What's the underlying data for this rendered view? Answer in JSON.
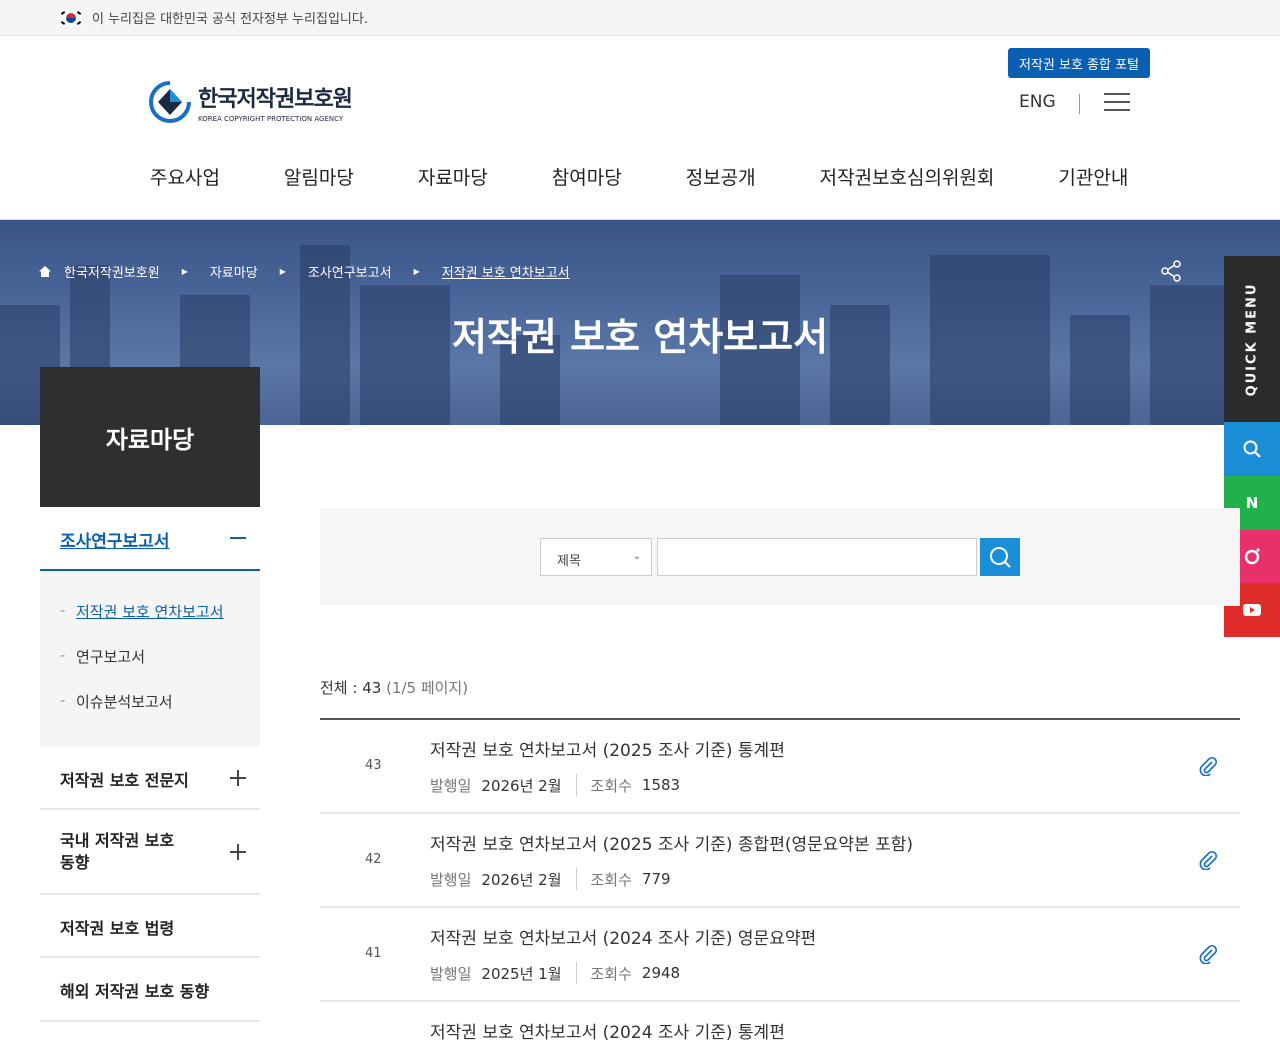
{
  "gov_bar": {
    "text": "이 누리집은 대한민국 공식 전자정부 누리집입니다."
  },
  "header": {
    "logo_name": "한국저작권보호원",
    "logo_sub": "KOREA COPYRIGHT PROTECTION AGENCY",
    "portal_button": "저작권 보호 종합 포털",
    "eng": "ENG"
  },
  "gnb": [
    "주요사업",
    "알림마당",
    "자료마당",
    "참여마당",
    "정보공개",
    "저작권보호심의위원회",
    "기관안내"
  ],
  "breadcrumb": [
    "한국저작권보호원",
    "자료마당",
    "조사연구보고서",
    "저작권 보호 연차보고서"
  ],
  "hero_title": "저작권 보호 연차보고서",
  "quick_menu": {
    "label": "QUICK MENU",
    "colors": [
      "#1a8fd8",
      "#21b14b",
      "#e8306a",
      "#e02b2b"
    ],
    "naver": "N"
  },
  "sidebar": {
    "title": "자료마당",
    "active": "조사연구보고서",
    "sub_items": [
      "저작권 보호 연차보고서",
      "연구보고서",
      "이슈분석보고서"
    ],
    "items": [
      "저작권 보호 전문지",
      "국내 저작권 보호\n동향",
      "저작권 보호 법령",
      "해외 저작권 보호 동향"
    ]
  },
  "search": {
    "select_value": "제목",
    "keyword": ""
  },
  "list": {
    "total_label": "전체 : 43",
    "page_info": "(1/5 페이지)",
    "date_label": "발행일",
    "views_label": "조회수",
    "rows": [
      {
        "no": "43",
        "title": "저작권 보호 연차보고서 (2025 조사 기준) 통계편",
        "date": "2026년 2월",
        "views": "1583"
      },
      {
        "no": "42",
        "title": "저작권 보호 연차보고서 (2025 조사 기준) 종합편(영문요약본 포함)",
        "date": "2026년 2월",
        "views": "779"
      },
      {
        "no": "41",
        "title": "저작권 보호 연차보고서 (2024 조사 기준) 영문요약편",
        "date": "2025년 1월",
        "views": "2948"
      },
      {
        "no": "",
        "title": "저작권 보호 연차보고서 (2024 조사 기준) 통계편",
        "date": "",
        "views": ""
      }
    ]
  }
}
